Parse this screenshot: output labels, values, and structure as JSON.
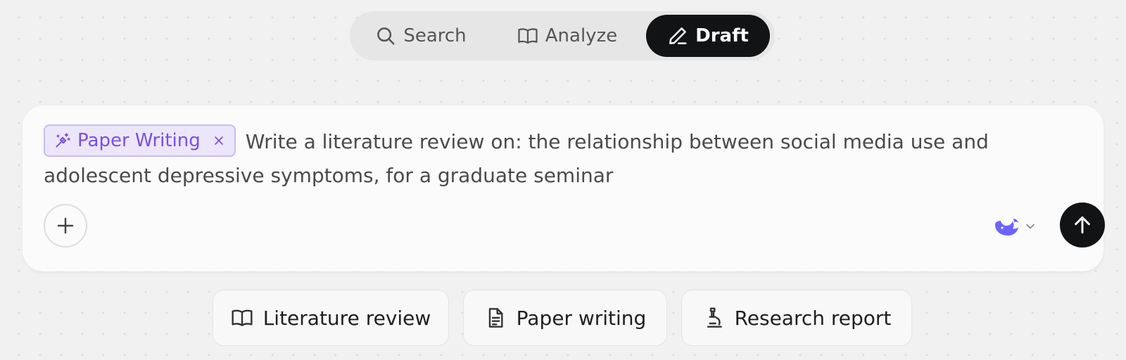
{
  "mode_switch": {
    "tabs": [
      {
        "label": "Search",
        "icon": "search-icon",
        "active": false
      },
      {
        "label": "Analyze",
        "icon": "book-open-icon",
        "active": false
      },
      {
        "label": "Draft",
        "icon": "pen-icon",
        "active": true
      }
    ]
  },
  "composer": {
    "tag": {
      "label": "Paper Writing",
      "icon": "magic-wand-icon",
      "remove_icon": "close-icon"
    },
    "prompt_text": "Write a literature review on:  the relationship between social media use and adolescent depressive symptoms, for a graduate seminar",
    "add_icon": "plus-icon",
    "model_icon": "whale-icon",
    "model_dropdown_icon": "chevron-down-icon",
    "send_icon": "arrow-up-icon"
  },
  "suggestions": [
    {
      "label": "Literature review",
      "icon": "book-open-icon"
    },
    {
      "label": "Paper writing",
      "icon": "document-icon"
    },
    {
      "label": "Research report",
      "icon": "microscope-icon"
    }
  ],
  "colors": {
    "accent_purple": "#7a4fe0",
    "tag_background": "#ece6fb",
    "active_tab": "#111315",
    "send_button": "#111315",
    "model_icon": "#6c63ff"
  }
}
